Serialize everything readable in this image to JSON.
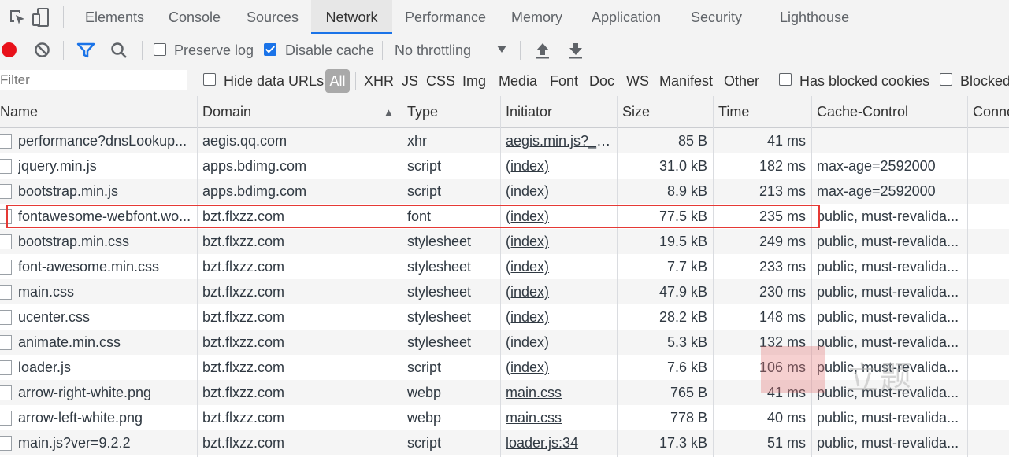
{
  "tabs": [
    "Elements",
    "Console",
    "Sources",
    "Network",
    "Performance",
    "Memory",
    "Application",
    "Security",
    "Lighthouse"
  ],
  "selected_tab": "Network",
  "toolbar": {
    "preserve_log": "Preserve log",
    "disable_cache": "Disable cache",
    "throttling": "No throttling"
  },
  "filterbar": {
    "placeholder": "Filter",
    "hide_data_urls": "Hide data URLs",
    "all": "All",
    "types": [
      "XHR",
      "JS",
      "CSS",
      "Img",
      "Media",
      "Font",
      "Doc",
      "WS",
      "Manifest",
      "Other"
    ],
    "has_blocked_cookies": "Has blocked cookies",
    "blocked": "Blocked"
  },
  "columns": [
    "Name",
    "Domain",
    "Type",
    "Initiator",
    "Size",
    "Time",
    "Cache-Control",
    "Conne"
  ],
  "sort_indicator": "▲",
  "rows": [
    {
      "name": "performance?dnsLookup...",
      "domain": "aegis.qq.com",
      "type": "xhr",
      "initiator": "aegis.min.js?_b...",
      "size": "85 B",
      "time": "41 ms",
      "cache": ""
    },
    {
      "name": "jquery.min.js",
      "domain": "apps.bdimg.com",
      "type": "script",
      "initiator": "(index)",
      "size": "31.0 kB",
      "time": "182 ms",
      "cache": "max-age=2592000"
    },
    {
      "name": "bootstrap.min.js",
      "domain": "apps.bdimg.com",
      "type": "script",
      "initiator": "(index)",
      "size": "8.9 kB",
      "time": "213 ms",
      "cache": "max-age=2592000"
    },
    {
      "name": "fontawesome-webfont.wo...",
      "domain": "bzt.flxzz.com",
      "type": "font",
      "initiator": "(index)",
      "size": "77.5 kB",
      "time": "235 ms",
      "cache": "public, must-revalida..."
    },
    {
      "name": "bootstrap.min.css",
      "domain": "bzt.flxzz.com",
      "type": "stylesheet",
      "initiator": "(index)",
      "size": "19.5 kB",
      "time": "249 ms",
      "cache": "public, must-revalida..."
    },
    {
      "name": "font-awesome.min.css",
      "domain": "bzt.flxzz.com",
      "type": "stylesheet",
      "initiator": "(index)",
      "size": "7.7 kB",
      "time": "233 ms",
      "cache": "public, must-revalida..."
    },
    {
      "name": "main.css",
      "domain": "bzt.flxzz.com",
      "type": "stylesheet",
      "initiator": "(index)",
      "size": "47.9 kB",
      "time": "230 ms",
      "cache": "public, must-revalida..."
    },
    {
      "name": "ucenter.css",
      "domain": "bzt.flxzz.com",
      "type": "stylesheet",
      "initiator": "(index)",
      "size": "28.2 kB",
      "time": "148 ms",
      "cache": "public, must-revalida..."
    },
    {
      "name": "animate.min.css",
      "domain": "bzt.flxzz.com",
      "type": "stylesheet",
      "initiator": "(index)",
      "size": "5.3 kB",
      "time": "132 ms",
      "cache": "public, must-revalida..."
    },
    {
      "name": "loader.js",
      "domain": "bzt.flxzz.com",
      "type": "script",
      "initiator": "(index)",
      "size": "7.6 kB",
      "time": "106 ms",
      "cache": "public, must-revalida..."
    },
    {
      "name": "arrow-right-white.png",
      "domain": "bzt.flxzz.com",
      "type": "webp",
      "initiator": "main.css",
      "size": "765 B",
      "time": "41 ms",
      "cache": "public, must-revalida..."
    },
    {
      "name": "arrow-left-white.png",
      "domain": "bzt.flxzz.com",
      "type": "webp",
      "initiator": "main.css",
      "size": "778 B",
      "time": "40 ms",
      "cache": "public, must-revalida..."
    },
    {
      "name": "main.js?ver=9.2.2",
      "domain": "bzt.flxzz.com",
      "type": "script",
      "initiator": "loader.js:34",
      "size": "17.3 kB",
      "time": "51 ms",
      "cache": "public, must-revalida..."
    }
  ],
  "watermark": "立题",
  "colors": {
    "accent": "#1a73e8",
    "record": "#e8111a",
    "highlight": "#e53935"
  }
}
